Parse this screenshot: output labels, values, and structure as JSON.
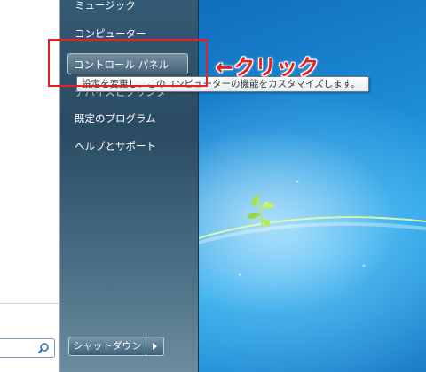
{
  "start_menu": {
    "items": [
      {
        "label": "ミュージック"
      },
      {
        "label": "コンピューター"
      },
      {
        "label": "コントロール パネル"
      },
      {
        "label": "デバイスとプリンター"
      },
      {
        "label": "既定のプログラム"
      },
      {
        "label": "ヘルプとサポート"
      }
    ],
    "shutdown_label": "シャットダウン",
    "search_placeholder": ""
  },
  "tooltip": {
    "text": "設定を変更し、このコンピューターの機能をカスタマイズします。"
  },
  "annotation": {
    "text": "←クリック"
  },
  "colors": {
    "annotation": "#e82020",
    "menu_panel": "#2a4b62",
    "desktop": "#1b89d3"
  },
  "icons": [
    "search-icon",
    "arrow-right-icon",
    "windows-logo-icon",
    "plant-icon"
  ]
}
